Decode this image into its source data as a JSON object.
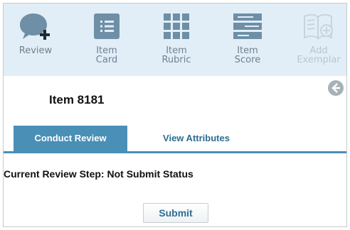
{
  "toolbar": {
    "items": [
      {
        "label": "Review",
        "icon": "review-comment-plus-icon",
        "enabled": true
      },
      {
        "label": "Item\nCard",
        "icon": "item-card-icon",
        "enabled": true
      },
      {
        "label": "Item\nRubric",
        "icon": "item-rubric-grid-icon",
        "enabled": true
      },
      {
        "label": "Item\nScore",
        "icon": "item-score-icon",
        "enabled": true
      },
      {
        "label": "Add\nExemplar",
        "icon": "add-exemplar-book-icon",
        "enabled": false
      }
    ],
    "icon_color": "#6e8fa6",
    "disabled_icon_color": "#c8d4dd"
  },
  "header": {
    "title": "Item 8181",
    "back_icon": "back-arrow-circle-icon"
  },
  "tabs": [
    {
      "label": "Conduct Review",
      "active": true
    },
    {
      "label": "View Attributes",
      "active": false
    }
  ],
  "review": {
    "step_text": "Current Review Step: Not Submit Status",
    "submit_label": "Submit"
  },
  "colors": {
    "toolbar_bg": "#e2eef7",
    "tab_active": "#4a8fb6",
    "link_blue": "#2d6d92"
  }
}
